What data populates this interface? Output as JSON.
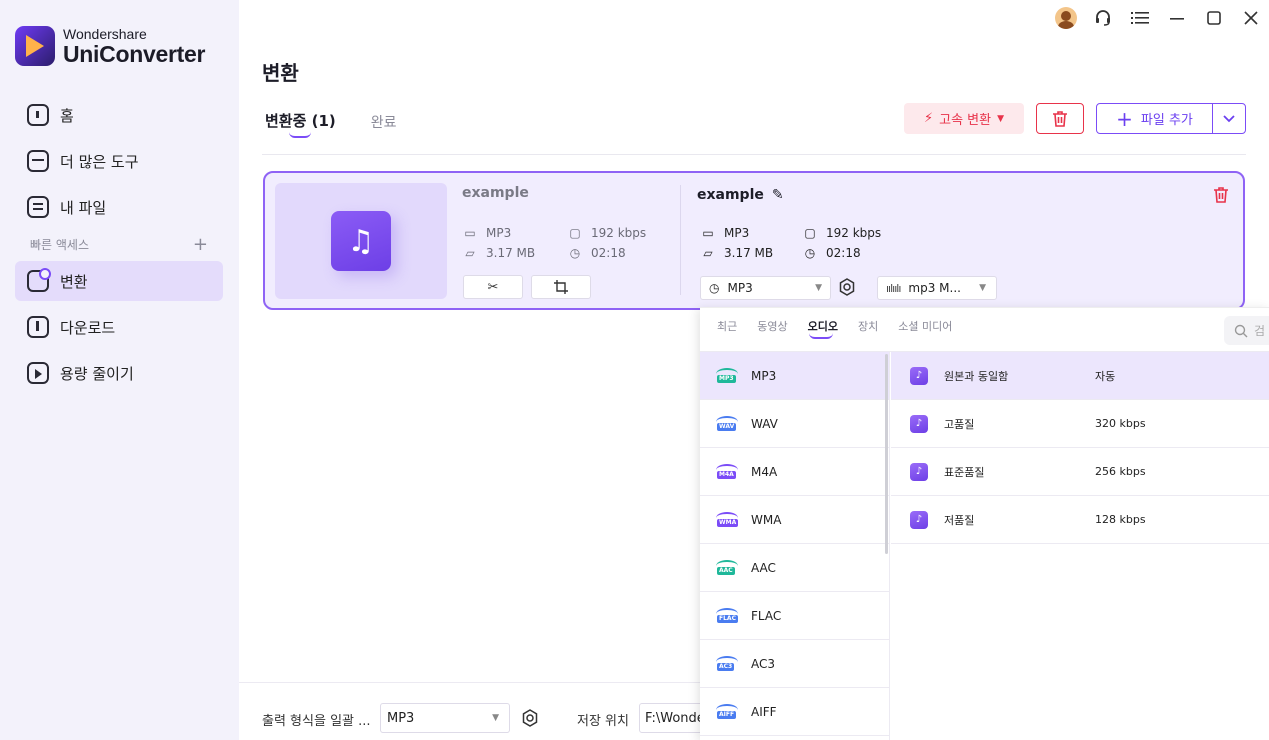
{
  "app": {
    "brand_small": "Wondershare",
    "brand_big": "UniConverter"
  },
  "sidebar": {
    "items": [
      {
        "label": "홈",
        "icon": "home-icon"
      },
      {
        "label": "더 많은 도구",
        "icon": "toolbox-icon"
      },
      {
        "label": "내 파일",
        "icon": "files-icon"
      }
    ],
    "quick_access_label": "빠른 액세스",
    "quick_items": [
      {
        "label": "변환",
        "icon": "convert-icon",
        "active": true
      },
      {
        "label": "다운로드",
        "icon": "download-icon"
      },
      {
        "label": "용량 줄이기",
        "icon": "compress-icon"
      }
    ]
  },
  "page": {
    "title": "변환",
    "tabs": [
      {
        "label": "변환중 (1)",
        "active": true
      },
      {
        "label": "완료",
        "active": false
      }
    ]
  },
  "toolbar": {
    "fast_convert_label": "고속 변환",
    "add_file_label": "파일 추가"
  },
  "file": {
    "source": {
      "name": "example",
      "format": "MP3",
      "size": "3.17 MB",
      "bitrate": "192 kbps",
      "duration": "02:18"
    },
    "target": {
      "name": "example",
      "format": "MP3",
      "size": "3.17 MB",
      "bitrate": "192 kbps",
      "duration": "02:18"
    },
    "format_select": "MP3",
    "quality_select": "mp3 M..."
  },
  "format_panel": {
    "tabs": [
      {
        "label": "최근",
        "active": false
      },
      {
        "label": "동영상",
        "active": false
      },
      {
        "label": "오디오",
        "active": true
      },
      {
        "label": "장치",
        "active": false
      },
      {
        "label": "소셜 미디어",
        "active": false
      }
    ],
    "search_placeholder": "검",
    "formats": [
      {
        "name": "MP3",
        "badge": "MP3",
        "color": "#1fb89a",
        "selected": true
      },
      {
        "name": "WAV",
        "badge": "WAV",
        "color": "#4a7cf0",
        "selected": false
      },
      {
        "name": "M4A",
        "badge": "M4A",
        "color": "#7b4cf7",
        "selected": false
      },
      {
        "name": "WMA",
        "badge": "WMA",
        "color": "#7b4cf7",
        "selected": false
      },
      {
        "name": "AAC",
        "badge": "AAC",
        "color": "#1fb89a",
        "selected": false
      },
      {
        "name": "FLAC",
        "badge": "FLAC",
        "color": "#4a7cf0",
        "selected": false
      },
      {
        "name": "AC3",
        "badge": "AC3",
        "color": "#4a7cf0",
        "selected": false
      },
      {
        "name": "AIFF",
        "badge": "AIFF",
        "color": "#4a7cf0",
        "selected": false
      }
    ],
    "qualities": [
      {
        "name": "원본과 동일함",
        "value": "자동",
        "selected": true
      },
      {
        "name": "고품질",
        "value": "320 kbps",
        "selected": false
      },
      {
        "name": "표준품질",
        "value": "256 kbps",
        "selected": false
      },
      {
        "name": "저품질",
        "value": "128 kbps",
        "selected": false
      }
    ]
  },
  "bottom": {
    "output_format_label": "출력 형식을 일괄 ...",
    "output_format_value": "MP3",
    "save_location_label": "저장 위치",
    "save_location_value": "F:\\Wondershare UniConverter"
  },
  "colors": {
    "accent": "#7b4cf7",
    "danger": "#e8334a",
    "sidebar_bg": "#f3f2fb",
    "selected_bg": "#ece6fd"
  }
}
